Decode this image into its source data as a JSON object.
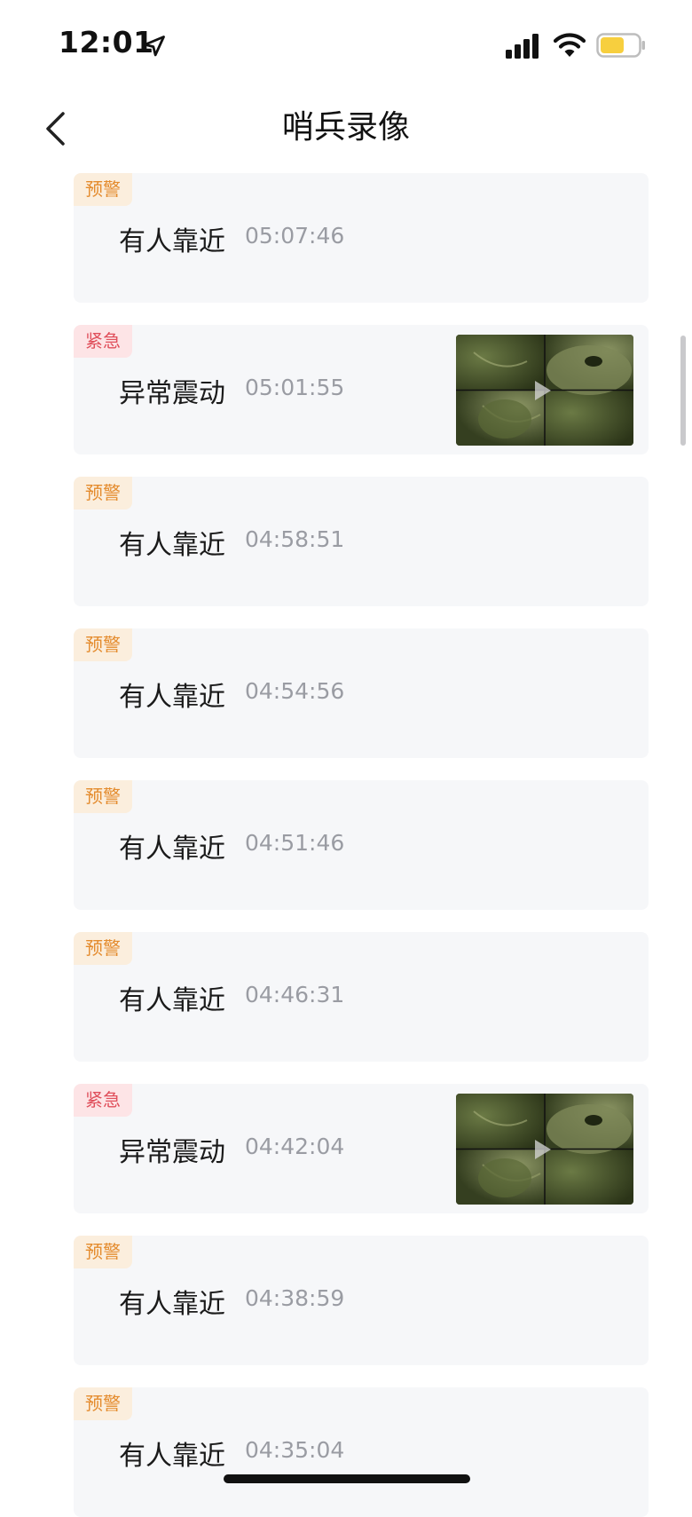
{
  "status_bar": {
    "time": "12:01",
    "icons": [
      "location-arrow-icon",
      "signal-icon",
      "wifi-icon",
      "battery-icon"
    ],
    "battery_color": "#f7cf3e"
  },
  "nav": {
    "title": "哨兵录像",
    "back_icon": "chevron-left-icon"
  },
  "colors": {
    "warn_text": "#e48b2d",
    "warn_bg": "#fbeedd",
    "urgent_text": "#e0505c",
    "urgent_bg": "#fde4e6",
    "card_bg": "#f6f7f9"
  },
  "events": [
    {
      "badge": "预警",
      "level": "warn",
      "label": "有人靠近",
      "time": "05:07:46",
      "has_thumbnail": false
    },
    {
      "badge": "紧急",
      "level": "urgent",
      "label": "异常震动",
      "time": "05:01:55",
      "has_thumbnail": true
    },
    {
      "badge": "预警",
      "level": "warn",
      "label": "有人靠近",
      "time": "04:58:51",
      "has_thumbnail": false
    },
    {
      "badge": "预警",
      "level": "warn",
      "label": "有人靠近",
      "time": "04:54:56",
      "has_thumbnail": false
    },
    {
      "badge": "预警",
      "level": "warn",
      "label": "有人靠近",
      "time": "04:51:46",
      "has_thumbnail": false
    },
    {
      "badge": "预警",
      "level": "warn",
      "label": "有人靠近",
      "time": "04:46:31",
      "has_thumbnail": false
    },
    {
      "badge": "紧急",
      "level": "urgent",
      "label": "异常震动",
      "time": "04:42:04",
      "has_thumbnail": true
    },
    {
      "badge": "预警",
      "level": "warn",
      "label": "有人靠近",
      "time": "04:38:59",
      "has_thumbnail": false
    },
    {
      "badge": "预警",
      "level": "warn",
      "label": "有人靠近",
      "time": "04:35:04",
      "has_thumbnail": false
    }
  ]
}
